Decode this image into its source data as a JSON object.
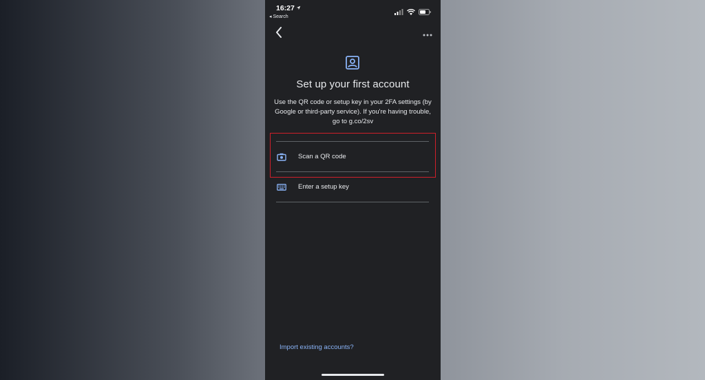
{
  "status_bar": {
    "time": "16:27",
    "back_to_app": "◂ Search"
  },
  "navigation": {
    "back_icon": "chevron-left-icon",
    "more_icon": "more-horizontal-icon"
  },
  "header": {
    "icon": "account-box-icon",
    "title": "Set up your first account",
    "description": "Use the QR code or setup key in your 2FA settings (by Google or third-party service). If you're having trouble, go to g.co/2sv"
  },
  "options": [
    {
      "label": "Scan a QR code",
      "icon": "camera-icon"
    },
    {
      "label": "Enter a setup key",
      "icon": "keyboard-icon"
    }
  ],
  "footer": {
    "import_link": "Import existing accounts?"
  },
  "colors": {
    "background": "#202124",
    "accent": "#8ab4f8",
    "highlight_border": "#d0202a",
    "text": "#e8eaed",
    "divider": "#5f6368"
  }
}
